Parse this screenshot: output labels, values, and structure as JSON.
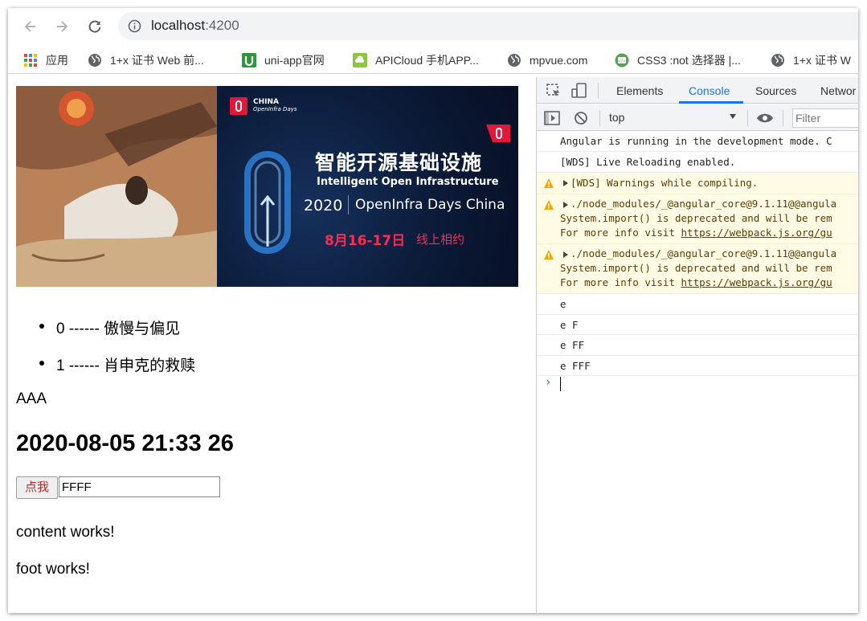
{
  "browser": {
    "url_host": "localhost",
    "url_port": ":4200"
  },
  "bookmarks": [
    {
      "label": "应用",
      "icon": "apps-grid-icon"
    },
    {
      "label": "1+x 证书 Web 前...",
      "icon": "globe-icon"
    },
    {
      "label": "uni-app官网",
      "icon": "uniapp-logo-icon"
    },
    {
      "label": "APICloud 手机APP...",
      "icon": "apicloud-logo-icon"
    },
    {
      "label": "mpvue.com",
      "icon": "globe-icon"
    },
    {
      "label": "CSS3 :not 选择器 |...",
      "icon": "css3-logo-icon"
    },
    {
      "label": "1+x 证书 W",
      "icon": "globe-icon"
    }
  ],
  "page": {
    "banner": {
      "logo_line1": "CHINA",
      "logo_line2": "OpenInfra Days",
      "headline_cn": "智能开源基础设施",
      "headline_en": "Intelligent Open Infrastructure",
      "year": "2020",
      "event": "OpenInfra Days China",
      "date": "8月16-17日",
      "online": "线上相约"
    },
    "list": [
      {
        "index": "0",
        "sep": "------",
        "title": "傲慢与偏见"
      },
      {
        "index": "1",
        "sep": "------",
        "title": "肖申克的救赎"
      }
    ],
    "aaa_text": "AAA",
    "datetime": "2020-08-05 21:33 26",
    "click_label": "点我",
    "input_value": "FFFF",
    "content_text": "content works!",
    "foot_text": "foot works!"
  },
  "devtools": {
    "tabs": [
      "Elements",
      "Console",
      "Sources",
      "Networ"
    ],
    "active_tab": "Console",
    "context": "top",
    "filter_placeholder": "Filter",
    "accent": "#1a73e8",
    "messages": [
      {
        "type": "log",
        "lines": [
          "Angular is running in the development mode. C"
        ]
      },
      {
        "type": "log",
        "lines": [
          "[WDS] Live Reloading enabled."
        ]
      },
      {
        "type": "warn",
        "lines": [
          "[WDS] Warnings while compiling."
        ]
      },
      {
        "type": "warn",
        "lines": [
          "./node_modules/_@angular_core@9.1.11@@angula",
          "System.import() is deprecated and will be rem",
          "For more info visit "
        ],
        "link": "https://webpack.js.org/gu"
      },
      {
        "type": "warn",
        "lines": [
          "./node_modules/_@angular_core@9.1.11@@angula",
          "System.import() is deprecated and will be rem",
          "For more info visit "
        ],
        "link": "https://webpack.js.org/gu"
      },
      {
        "type": "log",
        "lines": [
          "e"
        ]
      },
      {
        "type": "log",
        "lines": [
          "e F"
        ]
      },
      {
        "type": "log",
        "lines": [
          "e FF"
        ]
      },
      {
        "type": "log",
        "lines": [
          "e FFF"
        ]
      }
    ]
  }
}
